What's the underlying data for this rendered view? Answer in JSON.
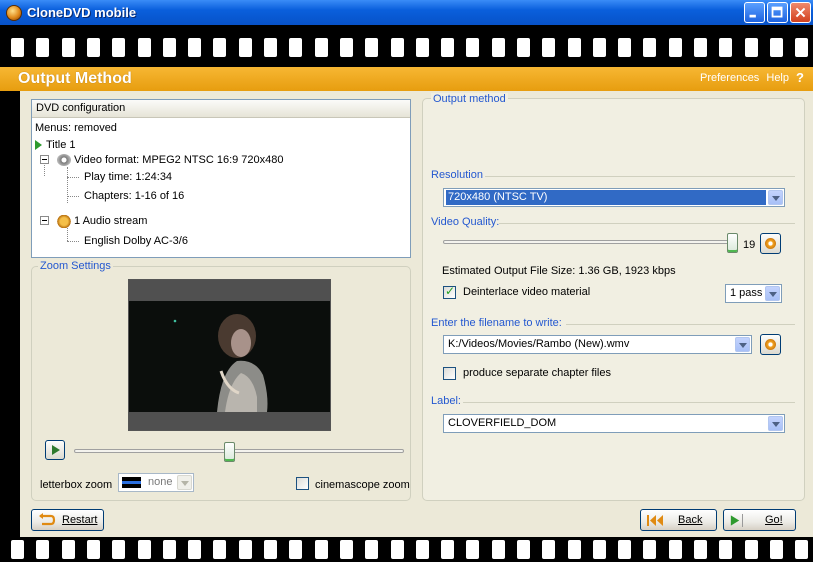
{
  "window": {
    "title": "CloneDVD mobile"
  },
  "header": {
    "title": "Output Method",
    "preferences": "Preferences",
    "help": "Help",
    "help_q": "?"
  },
  "dvd_config": {
    "title": "DVD configuration",
    "menus": "Menus: removed",
    "title_item": "Title 1",
    "video_format": "Video format: MPEG2 NTSC 16:9 720x480",
    "play_time": "Play time: 1:24:34",
    "chapters": "Chapters: 1-16 of 16",
    "audio_streams": "1 Audio stream",
    "audio_lang": "English Dolby AC-3/6"
  },
  "zoom": {
    "legend": "Zoom Settings",
    "letterbox_label": "letterbox zoom",
    "letterbox_value": "none",
    "cinemascope_label": "cinemascope zoom",
    "cinemascope_checked": false,
    "seek_position": 0.47
  },
  "output": {
    "legend": "Output method",
    "resolution_label": "Resolution",
    "resolution_value": "720x480 (NTSC TV)",
    "quality_label": "Video Quality:",
    "quality_value": "19",
    "quality_fraction": 1.0,
    "estimated_size": "Estimated Output File Size: 1.36 GB, 1923 kbps",
    "deinterlace_label": "Deinterlace video material",
    "deinterlace_checked": true,
    "pass_value": "1 pass",
    "filename_label": "Enter the filename to write:",
    "filename_value": "K:/Videos/Movies/Rambo (New).wmv",
    "separate_chapters_label": "produce separate chapter files",
    "separate_chapters_checked": false,
    "label_label": "Label:",
    "label_value": "CLOVERFIELD_DOM"
  },
  "buttons": {
    "restart": "Restart",
    "back": "Back",
    "go": "Go!"
  },
  "colors": {
    "title_bar": "#0a5fdc",
    "header": "#e79d0f",
    "section_blue": "#2458d0",
    "selection": "#316ac5"
  }
}
